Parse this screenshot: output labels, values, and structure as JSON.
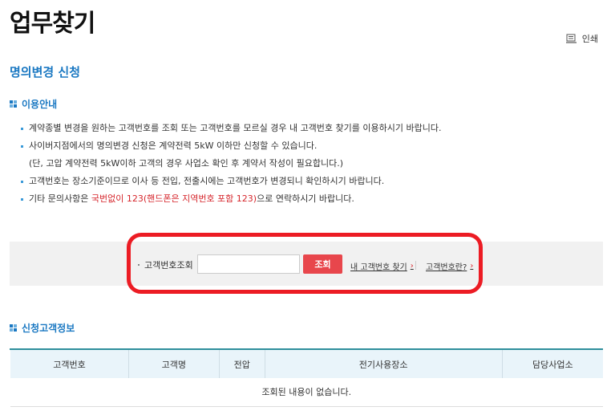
{
  "page": {
    "title": "업무찾기",
    "print_label": "인쇄"
  },
  "section": {
    "title": "명의변경 신청"
  },
  "info": {
    "heading": "이용안내",
    "items": [
      "계약종별 변경을 원하는 고객번호를 조회 또는 고객번호를 모르실 경우 내 고객번호 찾기를 이용하시기 바랍니다.",
      "사이버지점에서의 명의변경 신청은 계약전력 5kW 이하만 신청할 수 있습니다.",
      "(단, 고압 계약전력 5kW이하 고객의 경우 사업소 확인 후 계약서 작성이 필요합니다.)",
      "고객번호는 장소기준이므로 이사 등 전입, 전출시에는 고객번호가 변경되니 확인하시기 바랍니다."
    ],
    "contact_prefix": "기타 문의사항은 ",
    "contact_highlight": "국번없이 123(핸드폰은 지역번호 포함 123)",
    "contact_suffix": "으로 연락하시기 바랍니다."
  },
  "search": {
    "label": "고객번호조회",
    "value": "",
    "placeholder": "",
    "button_label": "조회",
    "find_link": "내 고객번호 찾기",
    "what_link": "고객번호란?"
  },
  "customer": {
    "heading": "신청고객정보",
    "columns": [
      "고객번호",
      "고객명",
      "전압",
      "전기사용장소",
      "담당사업소"
    ],
    "empty_message": "조회된 내용이 없습니다."
  },
  "colors": {
    "accent_blue": "#1a78c2",
    "highlight_red": "#d6262c",
    "button_red": "#e8464c",
    "outline_red": "#ec1c24"
  },
  "icons": {
    "print": "printer-icon",
    "heading": "grid-square-icon",
    "link_arrow": "chevron-right-icon"
  }
}
